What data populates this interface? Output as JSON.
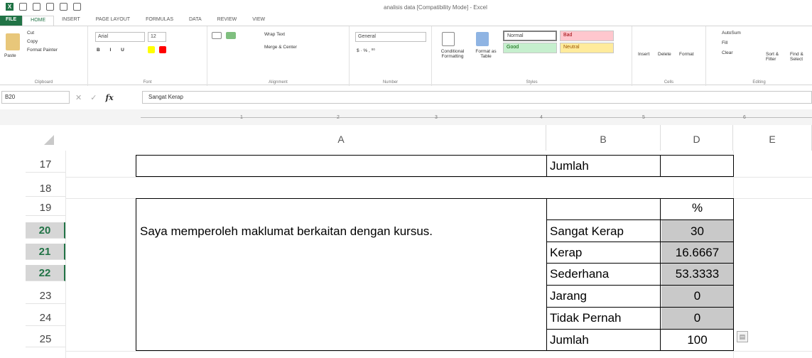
{
  "window": {
    "title": "analisis data [Compatibility Mode] - Excel"
  },
  "tabs": [
    "FILE",
    "HOME",
    "INSERT",
    "PAGE LAYOUT",
    "FORMULAS",
    "DATA",
    "REVIEW",
    "VIEW"
  ],
  "ribbon": {
    "clipboard": {
      "label": "Clipboard",
      "paste": "Paste",
      "cut": "Cut",
      "copy": "Copy",
      "format_painter": "Format Painter"
    },
    "font": {
      "label": "Font",
      "name": "Arial",
      "size": "12"
    },
    "alignment": {
      "label": "Alignment",
      "wrap_text": "Wrap Text",
      "merge_center": "Merge & Center"
    },
    "number": {
      "label": "Number",
      "format": "General"
    },
    "styles": {
      "label": "Styles",
      "conditional": "Conditional Formatting",
      "format_as_table": "Format as Table",
      "normal": "Normal",
      "bad": "Bad",
      "good": "Good",
      "neutral": "Neutral"
    },
    "cells": {
      "label": "Cells",
      "insert": "Insert",
      "delete": "Delete",
      "format": "Format"
    },
    "editing": {
      "label": "Editing",
      "autosum": "AutoSum",
      "fill": "Fill",
      "clear": "Clear",
      "sort_filter": "Sort & Filter",
      "find_select": "Find & Select"
    }
  },
  "formula_bar": {
    "name_box": "B20",
    "fx": "fx",
    "value": "Sangat Kerap"
  },
  "ruler_marks": [
    "1",
    "2",
    "3",
    "4",
    "5",
    "6"
  ],
  "columns": [
    "A",
    "B",
    "D",
    "E"
  ],
  "rows": [
    "17",
    "18",
    "19",
    "20",
    "21",
    "22",
    "23",
    "24",
    "25"
  ],
  "cells": {
    "b17": "Jumlah",
    "d19": "%",
    "a20": "Saya memperoleh maklumat berkaitan dengan kursus.",
    "b20": "Sangat Kerap",
    "d20": "30",
    "b21": "Kerap",
    "d21": "16.6667",
    "b22": "Sederhana",
    "d22": "53.3333",
    "b23": "Jarang",
    "d23": "0",
    "b24": "Tidak Pernah",
    "d24": "0",
    "b25": "Jumlah",
    "d25": "100"
  },
  "colors": {
    "accent": "#217346",
    "gray_fill": "#c9c9c9",
    "bad_fill": "#ffc7ce",
    "good_fill": "#c6efce",
    "neutral_fill": "#ffeb9c"
  }
}
